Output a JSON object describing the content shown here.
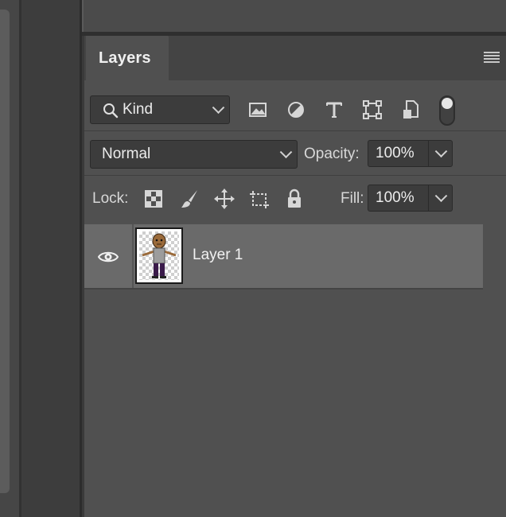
{
  "panel": {
    "tab_label": "Layers"
  },
  "filter": {
    "kind_label": "Kind",
    "filter_icons": [
      "image-filter-icon",
      "adjustment-filter-icon",
      "type-filter-icon",
      "shape-filter-icon",
      "smart-object-filter-icon"
    ],
    "filter_toggle_on": true
  },
  "blend": {
    "mode": "Normal",
    "opacity_label": "Opacity:",
    "opacity_value": "100%"
  },
  "lock": {
    "label": "Lock:",
    "icons": [
      "lock-transparent-pixels-icon",
      "lock-image-pixels-icon",
      "lock-position-icon",
      "lock-artboard-icon",
      "lock-all-icon"
    ],
    "fill_label": "Fill:",
    "fill_value": "100%"
  },
  "layers": [
    {
      "name": "Layer 1",
      "visible": true,
      "selected": true
    }
  ],
  "colors": {
    "panel_bg": "#505050",
    "selected_row": "#6a6a6a",
    "field_bg": "#3c3c3c"
  }
}
